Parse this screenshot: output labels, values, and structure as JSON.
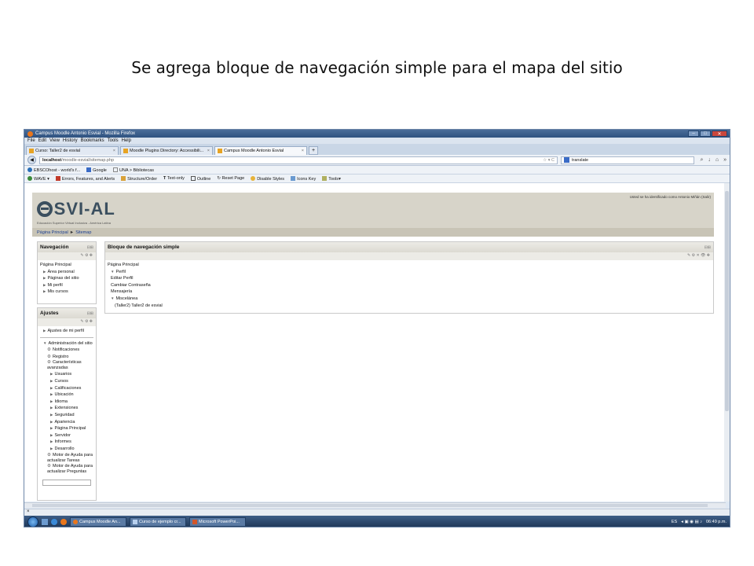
{
  "slide": {
    "title": "Se agrega bloque de navegación simple para el mapa del sitio"
  },
  "window": {
    "title": "Campus Moodle Antonio Esvial - Mozilla Firefox"
  },
  "menu": [
    "File",
    "Edit",
    "View",
    "History",
    "Bookmarks",
    "Tools",
    "Help"
  ],
  "tabs": [
    {
      "label": "Curso: Taller2 de esvial"
    },
    {
      "label": "Moodle Plugins Directory: Accessibili..."
    },
    {
      "label": "Campus Moodle Antonio Esvial"
    }
  ],
  "address": {
    "host": "localhost",
    "path": "/moodle-esvial/sitemap.php"
  },
  "search": {
    "value": "translate"
  },
  "bookmarks": [
    "EBSCOhost - world's f...",
    "Google",
    "UNA > Bibliotecas"
  ],
  "wave_toolbar": [
    "WAVE",
    "Errors, Features, and Alerts",
    "Structure/Order",
    "Text-only",
    "Outline",
    "Reset Page",
    "Disable Styles",
    "Icons Key",
    "Tools"
  ],
  "site": {
    "logo": "SVI-AL",
    "tagline": "Educación Superior Virtual Inclusiva - América Latina",
    "login_info": "Usted se ha identificado como Antonio Miñán (Salir)",
    "breadcrumb": [
      "Página Principal",
      "Sitemap"
    ],
    "breadcrumb_sep": "►"
  },
  "nav_block": {
    "title": "Navegación",
    "root": "Página Principal",
    "items": [
      "Área personal",
      "Páginas del sitio",
      "Mi perfil",
      "Mis cursos"
    ]
  },
  "settings_block": {
    "title": "Ajustes",
    "profile": "Ajustes de mi perfil",
    "admin": "Administración del sitio",
    "gear_items": [
      "Notificaciones",
      "Registro",
      "Características avanzadas"
    ],
    "items": [
      "Usuarios",
      "Cursos",
      "Calificaciones",
      "Ubicación",
      "Idioma",
      "Extensiones",
      "Seguridad",
      "Apariencia",
      "Página Principal",
      "Servidor",
      "Informes",
      "Desarrollo"
    ],
    "help_items": [
      "Motor de Ayuda para actualizar Tareas",
      "Motor de Ayuda para actualizar Preguntas"
    ]
  },
  "simple_block": {
    "title": "Bloque de navegación simple",
    "root": "Página Principal",
    "perfil": "Perfil",
    "perfil_items": [
      "Editar Perfil",
      "Cambiar Contraseña",
      "Mensajería"
    ],
    "misc": "Miscelánea",
    "misc_items": [
      "(Taller2) Taller2 de esvial"
    ]
  },
  "taskbar": {
    "buttons": [
      "Campus Moodle An...",
      "Curso de ejemplo cr...",
      "Microsoft PowerPoi..."
    ],
    "lang": "ES",
    "clock": "06:49 p.m."
  },
  "statusbar": {
    "close": "×"
  }
}
